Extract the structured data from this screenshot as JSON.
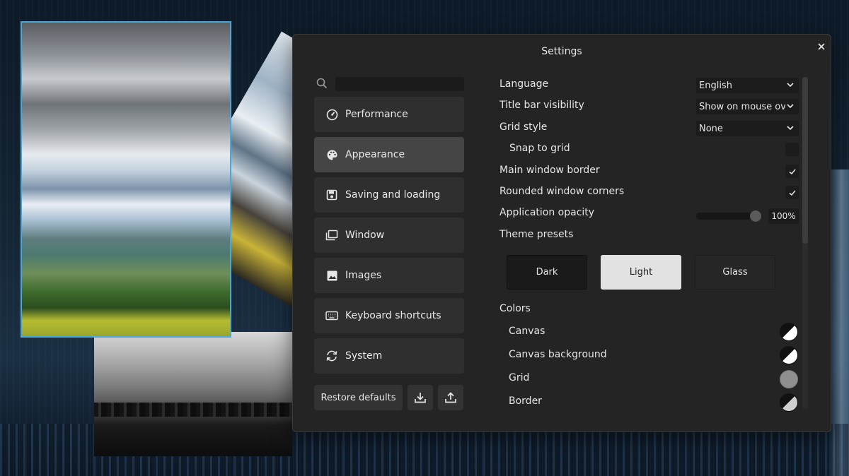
{
  "dialog": {
    "title": "Settings",
    "close_icon": "close-icon"
  },
  "search": {
    "icon": "search-icon",
    "value": "",
    "placeholder": ""
  },
  "nav": {
    "items": [
      {
        "label": "Performance",
        "icon": "speedometer-icon"
      },
      {
        "label": "Appearance",
        "icon": "palette-icon"
      },
      {
        "label": "Saving and loading",
        "icon": "save-icon"
      },
      {
        "label": "Window",
        "icon": "window-icon"
      },
      {
        "label": "Images",
        "icon": "image-icon"
      },
      {
        "label": "Keyboard shortcuts",
        "icon": "keyboard-icon"
      },
      {
        "label": "System",
        "icon": "sync-icon"
      }
    ],
    "active": "Appearance"
  },
  "footer": {
    "restore_label": "Restore defaults",
    "import_icon": "download-icon",
    "export_icon": "upload-icon"
  },
  "settings": {
    "language": {
      "label": "Language",
      "value": "English"
    },
    "title_bar": {
      "label": "Title bar visibility",
      "value": "Show on mouse over"
    },
    "grid_style": {
      "label": "Grid style",
      "value": "None"
    },
    "snap": {
      "label": "Snap to grid",
      "checked": false
    },
    "border": {
      "label": "Main window border",
      "checked": true
    },
    "rounded": {
      "label": "Rounded window corners",
      "checked": true
    },
    "opacity": {
      "label": "Application opacity",
      "value_text": "100%",
      "value": 1.0
    },
    "theme_presets": {
      "label": "Theme presets",
      "options": [
        "Dark",
        "Light",
        "Glass"
      ]
    },
    "colors": {
      "label": "Colors",
      "items": [
        {
          "label": "Canvas",
          "swatch": "black-white"
        },
        {
          "label": "Canvas background",
          "swatch": "black-white"
        },
        {
          "label": "Grid",
          "swatch": "#8f8f8f"
        },
        {
          "label": "Border",
          "swatch": "black-lightgrey"
        }
      ]
    }
  },
  "colors": {
    "dialog_bg": "#242424",
    "nav_item_bg": "#2f2f2f",
    "nav_item_active_bg": "#454545",
    "selection_border": "#4aa8d8",
    "preset_dark_bg": "#1a1a1a",
    "preset_light_bg": "#e2e2e2"
  }
}
